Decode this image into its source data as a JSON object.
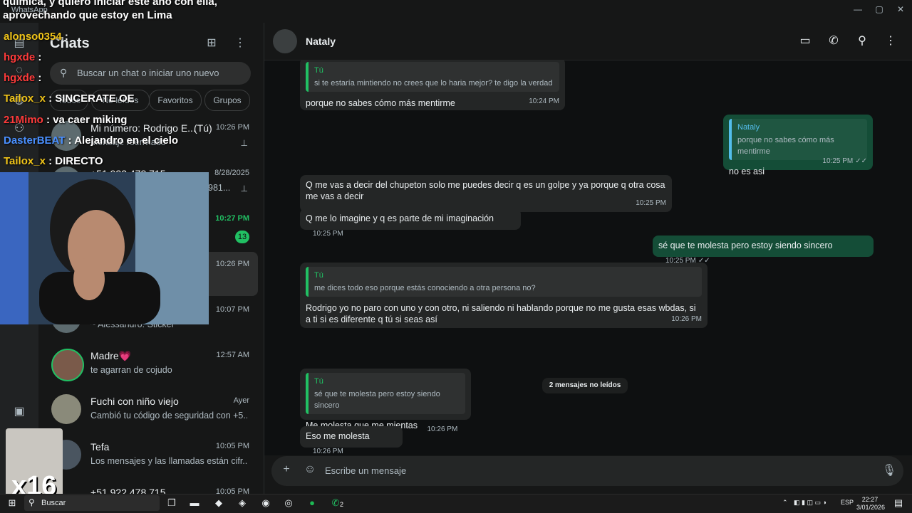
{
  "window": {
    "app_title": "WhatsApp",
    "min": "—",
    "max": "▢",
    "close": "✕"
  },
  "sidebar": {
    "title": "Chats",
    "search_placeholder": "Buscar un chat o iniciar uno nuevo",
    "filters": [
      "Todos",
      "No leídos",
      "Favoritos",
      "Grupos"
    ],
    "chats": [
      {
        "name": "Mi número: Rodrigo E...",
        "self_tag": "(Tú)",
        "preview": "Mensaje reenviado",
        "time": "10:26 PM",
        "pinned": true
      },
      {
        "name": "+51 922 478 715",
        "preview": "981...",
        "time": "8/28/2025",
        "pinned": true
      },
      {
        "name": "",
        "preview": "",
        "time": "10:27 PM",
        "unread": "13"
      },
      {
        "name": "",
        "preview": "",
        "time": "10:26 PM"
      },
      {
        "name": "",
        "preview": "~ Alessandro: Sticker",
        "time": "10:07 PM"
      },
      {
        "name": "Madre💗",
        "preview": "te agarran de cojudo",
        "time": "12:57 AM"
      },
      {
        "name": "Fuchi con niño viejo",
        "preview": "Cambió tu código de seguridad con +5...",
        "time": "Ayer"
      },
      {
        "name": "Tefa",
        "preview": "Los mensajes y las llamadas están cifr...",
        "time": "10:05 PM"
      },
      {
        "name": "+51 922 478 715",
        "preview": "",
        "time": "10:05 PM"
      }
    ]
  },
  "chat": {
    "contact": "Nataly",
    "messages": [
      {
        "dir": "in",
        "quote_who": "Tú",
        "quote": "si te estaría mintiendo no crees que lo haria mejor? te digo la verdad",
        "text": "porque no sabes cómo más mentirme",
        "time": "10:24 PM"
      },
      {
        "dir": "out",
        "quote_who": "Nataly",
        "quote": "porque no sabes cómo más mentirme",
        "text": "no es asi",
        "time": "10:25 PM"
      },
      {
        "dir": "in",
        "text": "Q me vas a decir del chupeton solo me puedes decir q es un golpe y ya porque q otra cosa me vas a decir",
        "time": "10:25 PM"
      },
      {
        "dir": "in",
        "text": "Q me lo imagine y q es parte de mi imaginación",
        "time": "10:25 PM"
      },
      {
        "dir": "out",
        "text": "sé que te molesta pero estoy siendo sincero",
        "time": "10:25 PM"
      },
      {
        "dir": "in",
        "quote_who": "Tú",
        "quote": "me dices todo eso porque estás conociendo a otra persona no?",
        "text": "Rodrigo yo no paro con uno y con otro, ni saliendo ni hablando porque no me gusta esas wbdas, si a ti si es diferente q tú si seas así",
        "time": "10:26 PM"
      },
      {
        "dir": "in",
        "quote_who": "Tú",
        "quote": "sé que te molesta pero estoy siendo sincero",
        "text": "Me molesta que me mientas",
        "time": "10:26 PM"
      },
      {
        "dir": "in",
        "text": "Eso me molesta",
        "time": "10:26 PM"
      }
    ],
    "unread_divider": "2 mensajes no leídos",
    "composer_placeholder": "Escribe un mensaje"
  },
  "stream_overlay": {
    "caption_line1": "química, y quiero iniciar este año con ella,",
    "caption_line2": "aprovechando que estoy en Lima",
    "chat": [
      {
        "user": "alonso0354",
        "msg": ":",
        "color": "#f0c419"
      },
      {
        "user": "hgxde",
        "msg": ":",
        "color": "#ff3b3b"
      },
      {
        "user": "hgxde",
        "msg": ":",
        "color": "#ff3b3b"
      },
      {
        "user": "Tailox_x",
        "msg": ": SINCERATE OE",
        "color": "#f0c419"
      },
      {
        "user": "21Mimo",
        "msg": ": va caer miking",
        "color": "#ff3b3b"
      },
      {
        "user": "DasterBEAT",
        "msg": ": Alejandro en el cielo",
        "color": "#4a90ff"
      },
      {
        "user": "Tailox_x",
        "msg": ": DIRECTO",
        "color": "#f0c419"
      }
    ],
    "sticker_label": "x16"
  },
  "taskbar": {
    "search": "Buscar",
    "lang": "ESP",
    "time": "22:27",
    "date": "3/01/2026",
    "wa_badge": "2"
  }
}
